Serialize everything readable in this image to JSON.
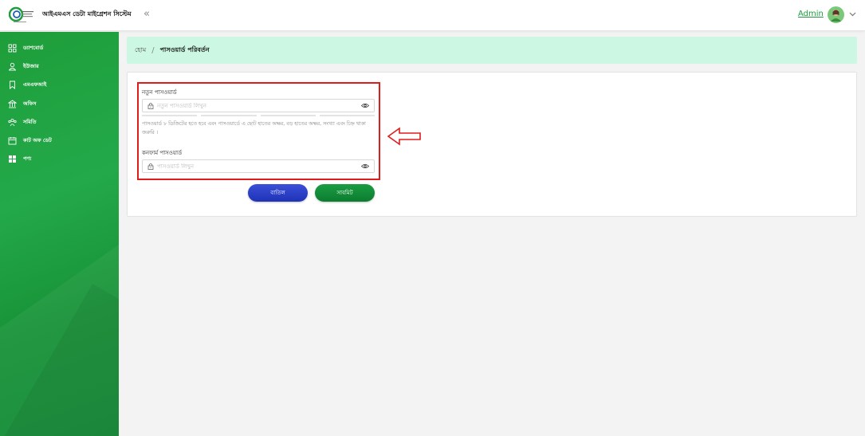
{
  "app": {
    "title": "আইএমএস ডেটা মাইগ্রেশন সিস্টেম",
    "logo_text": "Microcredit Regulatory Authority"
  },
  "header": {
    "user_name": "Admin"
  },
  "sidebar": {
    "items": [
      {
        "label": "ড্যাশবোর্ড",
        "icon": "grid-icon"
      },
      {
        "label": "ইউজার",
        "icon": "users-icon"
      },
      {
        "label": "এমএফআই",
        "icon": "bookmark-icon"
      },
      {
        "label": "অফিস",
        "icon": "bank-icon"
      },
      {
        "label": "সমিতি",
        "icon": "group-icon"
      },
      {
        "label": "কাট অফ ডেট",
        "icon": "calendar-icon"
      },
      {
        "label": "পণ্য",
        "icon": "apps-icon"
      }
    ]
  },
  "breadcrumb": {
    "home": "হোম",
    "separator": "/",
    "current": "পাসওয়ার্ড পরিবর্তন"
  },
  "form": {
    "new_password": {
      "label": "নতুন পাসওয়ার্ড",
      "placeholder": "নতুন পাসওয়ার্ড লিখুন",
      "value": ""
    },
    "hint": "পাসওয়ার্ড ৮ ডিজিটের হতে হবে এবং পাসওয়ার্ডে এ ছোট হাতের অক্ষর, বড় হাতের অক্ষর, সংখ্যা এবং চিহ্ন থাকা জরুরি ।",
    "confirm_password": {
      "label": "কনফার্ম পাসওয়ার্ড",
      "placeholder": "পাসওয়ার্ড লিখুন",
      "value": ""
    },
    "cancel_label": "বাতিল",
    "submit_label": "সাবমিট"
  },
  "colors": {
    "sidebar": "#1e9e3a",
    "breadcrumb_bg": "#ccf7e2",
    "cancel_button": "#2a3fc8",
    "submit_button": "#138c39",
    "highlight": "#e01b1b",
    "user_link": "#1e9b3e"
  }
}
